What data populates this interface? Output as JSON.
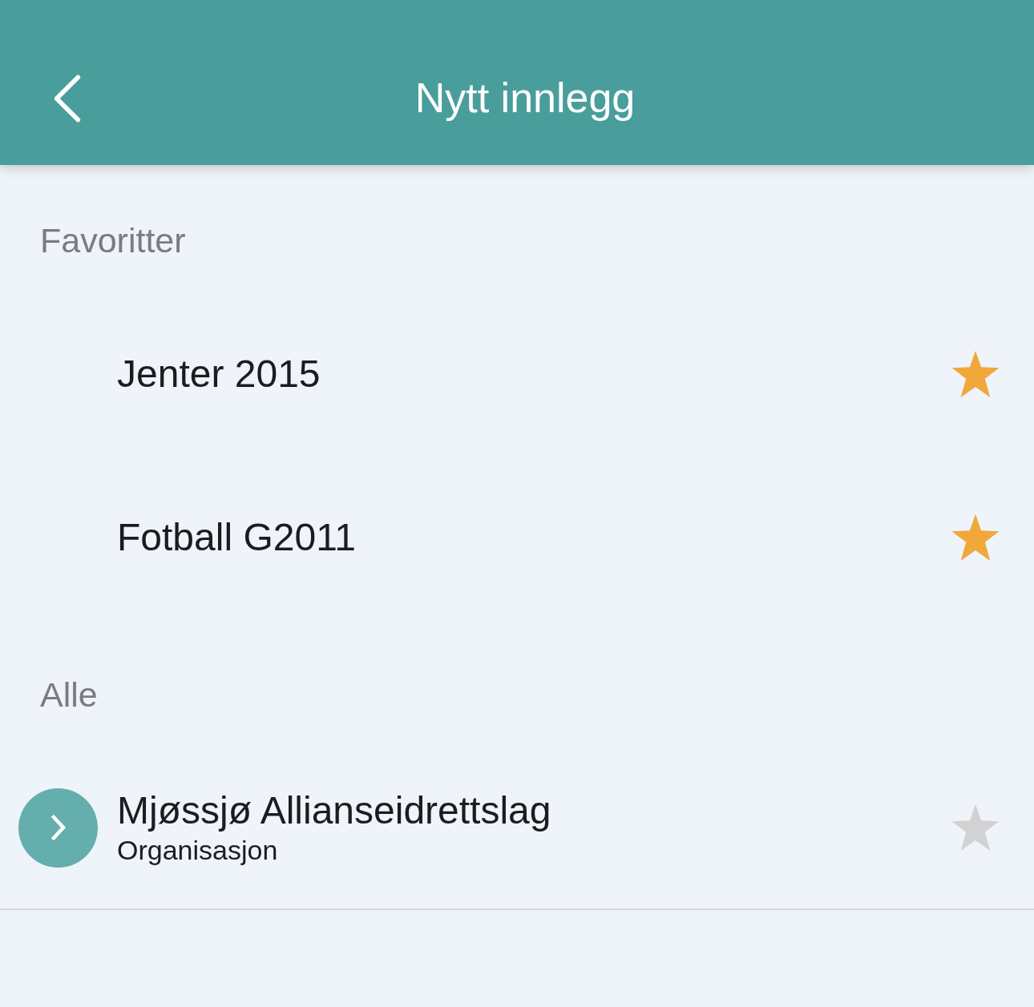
{
  "header": {
    "title": "Nytt innlegg"
  },
  "sections": [
    {
      "title": "Favoritter",
      "items": [
        {
          "kind": "group",
          "title": "Jenter 2015",
          "favorite": true
        },
        {
          "kind": "group",
          "title": "Fotball G2011",
          "favorite": true
        }
      ]
    },
    {
      "title": "Alle",
      "items": [
        {
          "kind": "organization",
          "title": "Mjøssjø Allianseidrettslag",
          "subtitle": "Organisasjon",
          "favorite": false
        }
      ]
    }
  ]
}
